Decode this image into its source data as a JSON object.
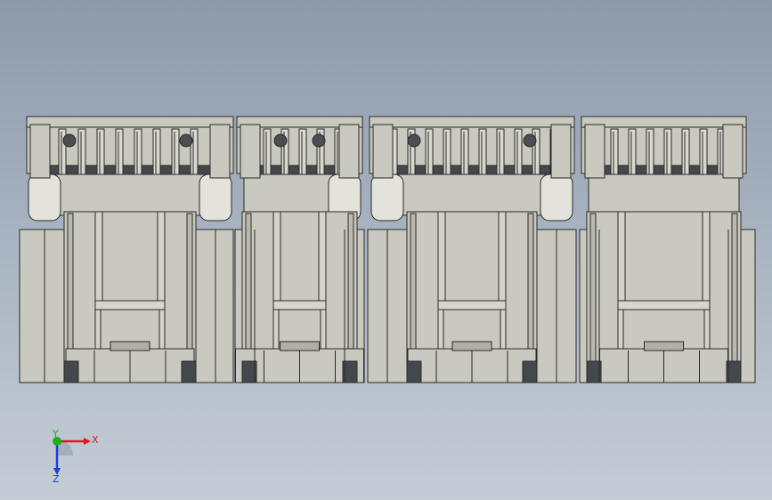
{
  "window": {
    "title": ""
  },
  "model_view": {
    "part_color": "#c9c9bf",
    "part_edge_color": "#2a2a2a",
    "cavity_color": "#44484c",
    "background_top": "#8e9aab",
    "background_bottom": "#c4ccd6",
    "connector_modules": 4
  },
  "triad": {
    "x_label": "X",
    "y_label": "Y",
    "z_label": "Z",
    "x_color": "#e01818",
    "y_color": "#19b319",
    "z_color": "#1c3fd8"
  }
}
